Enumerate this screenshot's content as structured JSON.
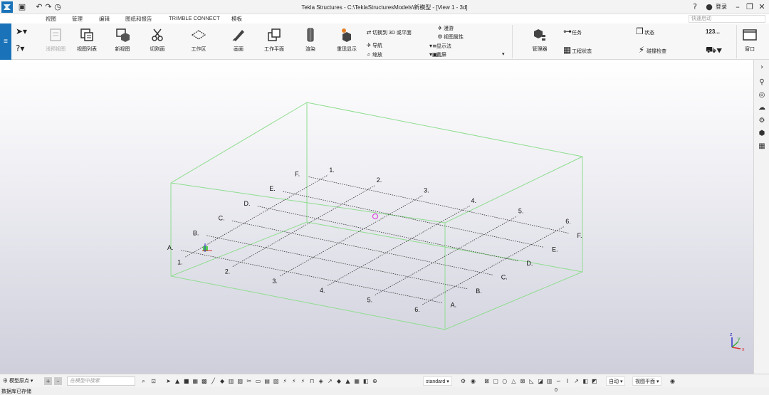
{
  "titlebar": {
    "title": "Tekla Structures - C:\\TeklaStructuresModels\\新模型 - [View 1 - 3d]",
    "login": "登录",
    "quick_search_placeholder": "快速启动"
  },
  "tabs": [
    {
      "label": "视图",
      "active": true
    },
    {
      "label": "管理",
      "active": false
    },
    {
      "label": "编辑",
      "active": false
    },
    {
      "label": "图纸和报告",
      "active": false
    },
    {
      "label": "TRIMBLE CONNECT",
      "active": false
    },
    {
      "label": "模板",
      "active": false
    }
  ],
  "ribbon": {
    "buttons": [
      {
        "label": "浅预视图",
        "icon": "clip-view-icon"
      },
      {
        "label": "视图列表",
        "icon": "view-list-icon"
      },
      {
        "label": "新视图",
        "icon": "new-view-icon"
      },
      {
        "label": "切割面",
        "icon": "cut-plane-icon"
      },
      {
        "label": "工作区",
        "icon": "work-area-icon"
      },
      {
        "label": "画面",
        "icon": "draw-icon"
      },
      {
        "label": "工作平面",
        "icon": "work-plane-icon"
      },
      {
        "label": "渲染",
        "icon": "render-icon"
      },
      {
        "label": "重现显示",
        "icon": "redraw-icon"
      }
    ],
    "small_left": [
      {
        "label": "切换到 3D 或平面",
        "icon": "switch-3d-icon"
      },
      {
        "label": "导航",
        "icon": "navigate-icon"
      },
      {
        "label": "缩放",
        "icon": "zoom-icon"
      }
    ],
    "small_right": [
      {
        "label": "漫游",
        "icon": "fly-icon"
      },
      {
        "label": "视图属性",
        "icon": "view-props-icon"
      },
      {
        "label": "显示法",
        "icon": "display-icon"
      },
      {
        "label": "截屏",
        "icon": "screenshot-icon"
      }
    ],
    "manager": "管理器",
    "task": "任务",
    "project_status": "工程状态",
    "state": "状态",
    "clash_check": "碰撞检查",
    "numbering": "123...",
    "window": "窗口"
  },
  "grid": {
    "letters": [
      "A",
      "B",
      "C",
      "D",
      "E",
      "F"
    ],
    "numbers": [
      "1",
      "2",
      "3",
      "4",
      "5",
      "6"
    ]
  },
  "bottombar": {
    "origin": "模型原点",
    "search_placeholder": "在模型中搜索",
    "filter": "standard",
    "auto": "自动",
    "view_plane": "视图平面"
  },
  "statusbar": {
    "text": "数据库已存储",
    "counter": "0"
  },
  "colors": {
    "brand_blue": "#1a73b8",
    "box_green": "#8fdd8f",
    "grid_line": "#333333"
  }
}
